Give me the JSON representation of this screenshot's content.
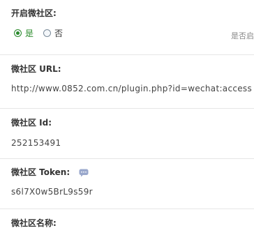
{
  "enable": {
    "label": "开启微社区:",
    "options": [
      {
        "label": "是",
        "checked": true
      },
      {
        "label": "否",
        "checked": false
      }
    ],
    "hint": "是否启"
  },
  "url": {
    "label": "微社区 URL:",
    "value": "http://www.0852.com.cn/plugin.php?id=wechat:access"
  },
  "id_field": {
    "label": "微社区 Id:",
    "value": "252153491"
  },
  "token": {
    "label": "微社区 Token:",
    "value": "s6l7X0w5BrL9s59r",
    "help_icon": "speech-bubble-icon"
  },
  "name": {
    "label": "微社区名称:"
  },
  "colors": {
    "checked": "#2a8a2a",
    "divider": "#e6e6e6",
    "help_icon": "#9aa8cc"
  }
}
